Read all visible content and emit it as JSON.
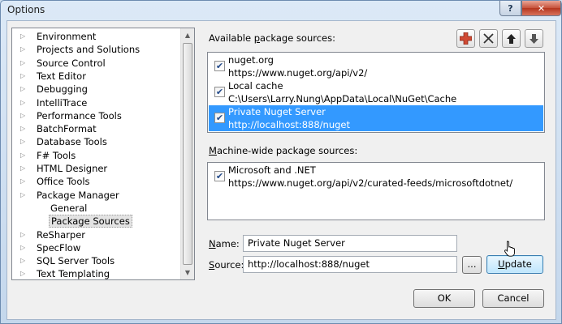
{
  "window": {
    "title": "Options",
    "help_label": "?",
    "close_label": "✕"
  },
  "tree": {
    "items": [
      {
        "label": "Environment",
        "expandable": true,
        "level": 0
      },
      {
        "label": "Projects and Solutions",
        "expandable": true,
        "level": 0
      },
      {
        "label": "Source Control",
        "expandable": true,
        "level": 0
      },
      {
        "label": "Text Editor",
        "expandable": true,
        "level": 0
      },
      {
        "label": "Debugging",
        "expandable": true,
        "level": 0
      },
      {
        "label": "IntelliTrace",
        "expandable": true,
        "level": 0
      },
      {
        "label": "Performance Tools",
        "expandable": true,
        "level": 0
      },
      {
        "label": "BatchFormat",
        "expandable": true,
        "level": 0
      },
      {
        "label": "Database Tools",
        "expandable": true,
        "level": 0
      },
      {
        "label": "F# Tools",
        "expandable": true,
        "level": 0
      },
      {
        "label": "HTML Designer",
        "expandable": true,
        "level": 0
      },
      {
        "label": "Office Tools",
        "expandable": true,
        "level": 0
      },
      {
        "label": "Package Manager",
        "expandable": true,
        "expanded": true,
        "level": 0
      },
      {
        "label": "General",
        "expandable": false,
        "level": 1
      },
      {
        "label": "Package Sources",
        "expandable": false,
        "level": 1,
        "selected": true
      },
      {
        "label": "ReSharper",
        "expandable": true,
        "level": 0
      },
      {
        "label": "SpecFlow",
        "expandable": true,
        "level": 0
      },
      {
        "label": "SQL Server Tools",
        "expandable": true,
        "level": 0
      },
      {
        "label": "Text Templating",
        "expandable": true,
        "level": 0
      }
    ]
  },
  "available": {
    "label_prefix": "Available ",
    "label_access": "p",
    "label_suffix": "ackage sources:",
    "sources": [
      {
        "name": "nuget.org",
        "url": "https://www.nuget.org/api/v2/",
        "checked": true,
        "selected": false
      },
      {
        "name": "Local cache",
        "url": "C:\\Users\\Larry.Nung\\AppData\\Local\\NuGet\\Cache",
        "checked": true,
        "selected": false
      },
      {
        "name": "Private Nuget Server",
        "url": "http://localhost:888/nuget",
        "checked": true,
        "selected": true
      }
    ]
  },
  "machine_wide": {
    "label_access": "M",
    "label_suffix": "achine-wide package sources:",
    "sources": [
      {
        "name": "Microsoft and .NET",
        "url": "https://www.nuget.org/api/v2/curated-feeds/microsoftdotnet/",
        "checked": true
      }
    ]
  },
  "toolbar": {
    "add_icon": "plus-icon",
    "remove_icon": "x-icon",
    "up_icon": "arrow-up-icon",
    "down_icon": "arrow-down-icon"
  },
  "form": {
    "name_access": "N",
    "name_suffix": "ame:",
    "name_value": "Private Nuget Server",
    "source_access": "S",
    "source_suffix": "ource:",
    "source_value": "http://localhost:888/nuget",
    "browse_label": "...",
    "update_access": "U",
    "update_suffix": "pdate"
  },
  "footer": {
    "ok_label": "OK",
    "cancel_label": "Cancel"
  },
  "colors": {
    "selection": "#3399ff",
    "add_icon": "#d04a34"
  }
}
